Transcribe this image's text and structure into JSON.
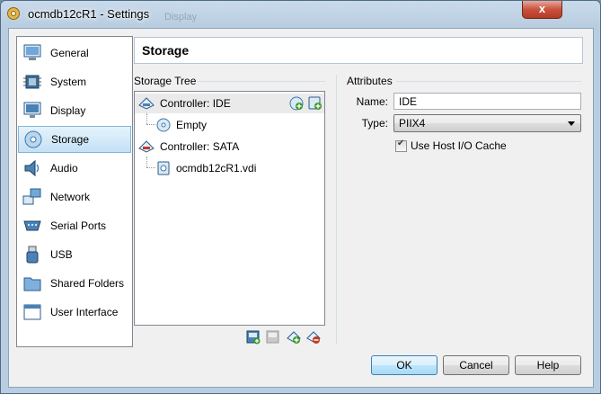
{
  "window": {
    "title": "ocmdb12cR1 - Settings",
    "background_ghost_text": "Display",
    "close_label": "x"
  },
  "sidebar": {
    "items": [
      {
        "label": "General",
        "icon": "general-icon"
      },
      {
        "label": "System",
        "icon": "chip-icon"
      },
      {
        "label": "Display",
        "icon": "monitor-icon"
      },
      {
        "label": "Storage",
        "icon": "disk-icon",
        "selected": true
      },
      {
        "label": "Audio",
        "icon": "speaker-icon"
      },
      {
        "label": "Network",
        "icon": "network-icon"
      },
      {
        "label": "Serial Ports",
        "icon": "serial-port-icon"
      },
      {
        "label": "USB",
        "icon": "usb-icon"
      },
      {
        "label": "Shared Folders",
        "icon": "folder-icon"
      },
      {
        "label": "User Interface",
        "icon": "window-icon"
      }
    ]
  },
  "page": {
    "title": "Storage"
  },
  "storage_tree": {
    "label": "Storage Tree",
    "rows": [
      {
        "label": "Controller: IDE",
        "selected": true
      },
      {
        "label": "Empty"
      },
      {
        "label": "Controller: SATA"
      },
      {
        "label": "ocmdb12cR1.vdi"
      }
    ],
    "toolbar": [
      "add-attachment-icon",
      "remove-attachment-icon",
      "add-controller-icon",
      "remove-controller-icon"
    ]
  },
  "attributes": {
    "label": "Attributes",
    "name_label": "Name:",
    "name_value": "IDE",
    "type_label": "Type:",
    "type_value": "PIIX4",
    "host_io_cache_label": "Use Host I/O Cache",
    "host_io_cache_checked": true
  },
  "buttons": {
    "ok": "OK",
    "cancel": "Cancel",
    "help": "Help"
  },
  "colors": {
    "selection": "#c4e1f5",
    "tree_selection": "#eaeaea",
    "title_bar": "#c9daea"
  }
}
